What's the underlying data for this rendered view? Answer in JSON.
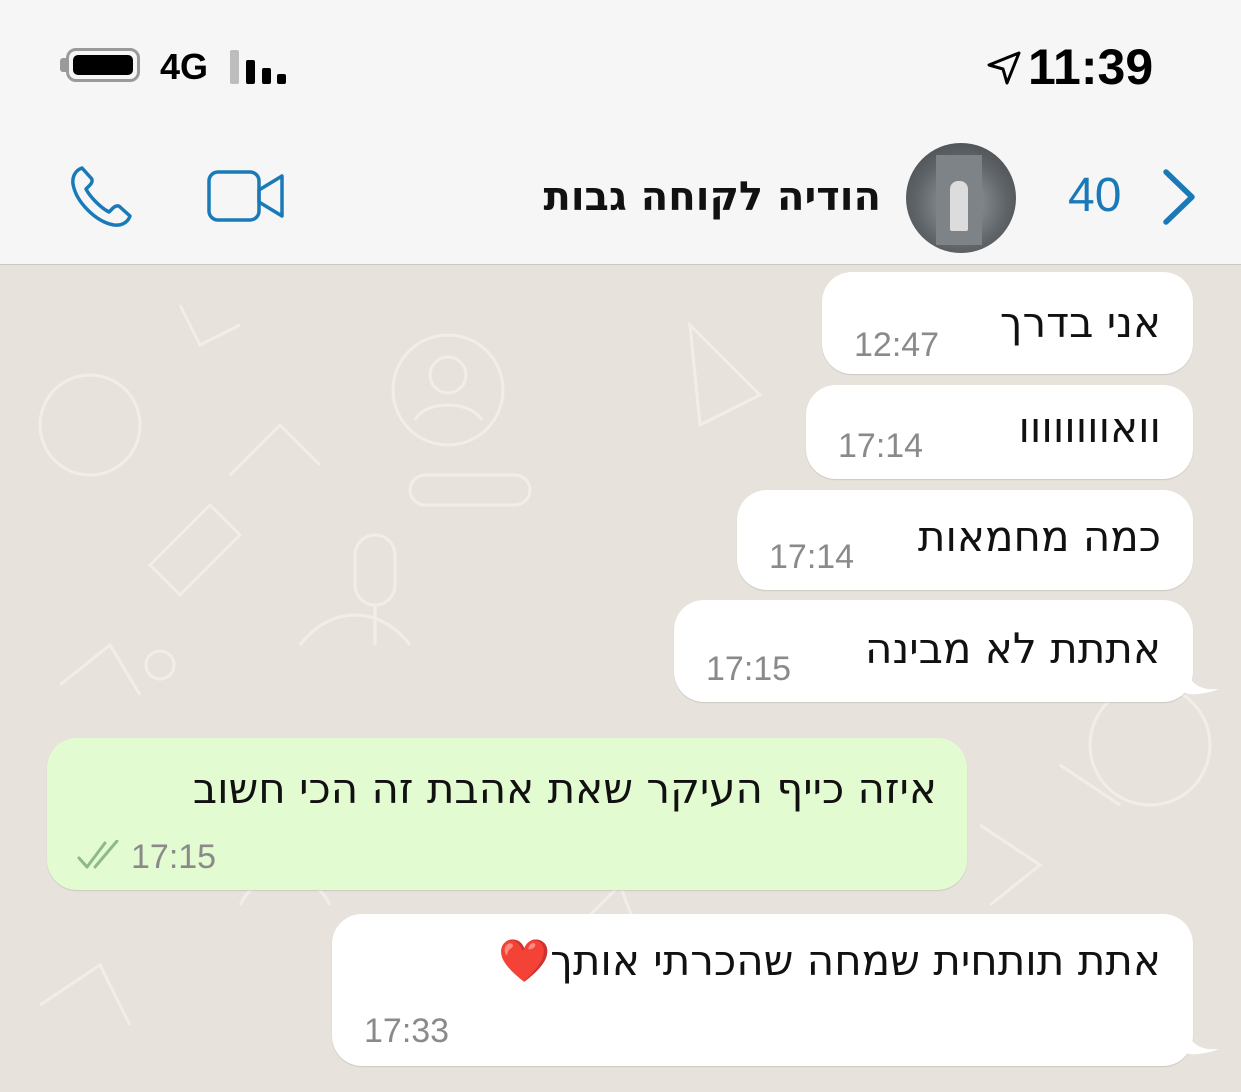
{
  "status_bar": {
    "network": "4G",
    "time": "11:39",
    "icons": [
      "battery-icon",
      "signal-icon",
      "location-arrow-icon"
    ]
  },
  "header": {
    "back_count": "40",
    "contact_name": "הודיה לקוחה גבות",
    "icons": [
      "chevron-back-icon",
      "video-call-icon",
      "phone-call-icon"
    ]
  },
  "messages": [
    {
      "direction": "incoming",
      "text": "אני בדרך",
      "time": "12:47"
    },
    {
      "direction": "incoming",
      "text": "וואוווווווו",
      "time": "17:14"
    },
    {
      "direction": "incoming",
      "text": "כמה מחמאות",
      "time": "17:14"
    },
    {
      "direction": "incoming",
      "text": "אתתת לא מבינה",
      "time": "17:15"
    },
    {
      "direction": "outgoing",
      "text": "איזה כייף העיקר שאת אהבת זה הכי חשוב",
      "time": "17:15",
      "status": "read"
    },
    {
      "direction": "incoming",
      "text": "אתת תותחית שמחה שהכרתי אותך❤️",
      "time": "17:33"
    }
  ],
  "colors": {
    "accent": "#1a7ab8",
    "chat_background": "#e7e3dc",
    "incoming_bubble": "#ffffff",
    "outgoing_bubble": "#e3fbd0",
    "timestamp": "#8a8a8a"
  }
}
